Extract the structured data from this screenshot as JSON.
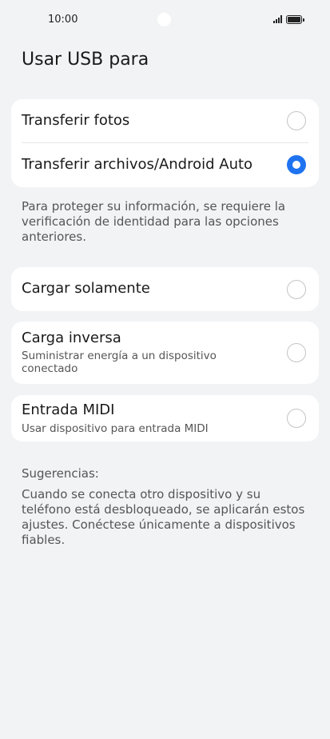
{
  "status_bar": {
    "time": "10:00"
  },
  "title": "Usar USB para",
  "options_group": {
    "items": [
      {
        "label": "Transferir fotos",
        "selected": false
      },
      {
        "label": "Transferir archivos/Android Auto",
        "selected": true
      }
    ]
  },
  "identity_note": "Para proteger su información, se requiere la verificación de identidad para las opciones anteriores.",
  "charge_only": {
    "label": "Cargar solamente",
    "selected": false
  },
  "reverse_charge": {
    "label": "Carga inversa",
    "sublabel": "Suministrar energía a un dispositivo conectado",
    "selected": false
  },
  "midi": {
    "label": "Entrada MIDI",
    "sublabel": "Usar dispositivo para entrada MIDI",
    "selected": false
  },
  "tips": {
    "heading": "Sugerencias:",
    "text": "Cuando se conecta otro dispositivo y su teléfono está desbloqueado, se aplicarán estos ajustes. Conéctese únicamente a dispositivos fiables."
  },
  "colors": {
    "accent": "#1f73f0",
    "background": "#f1f3f5",
    "card": "#ffffff"
  }
}
